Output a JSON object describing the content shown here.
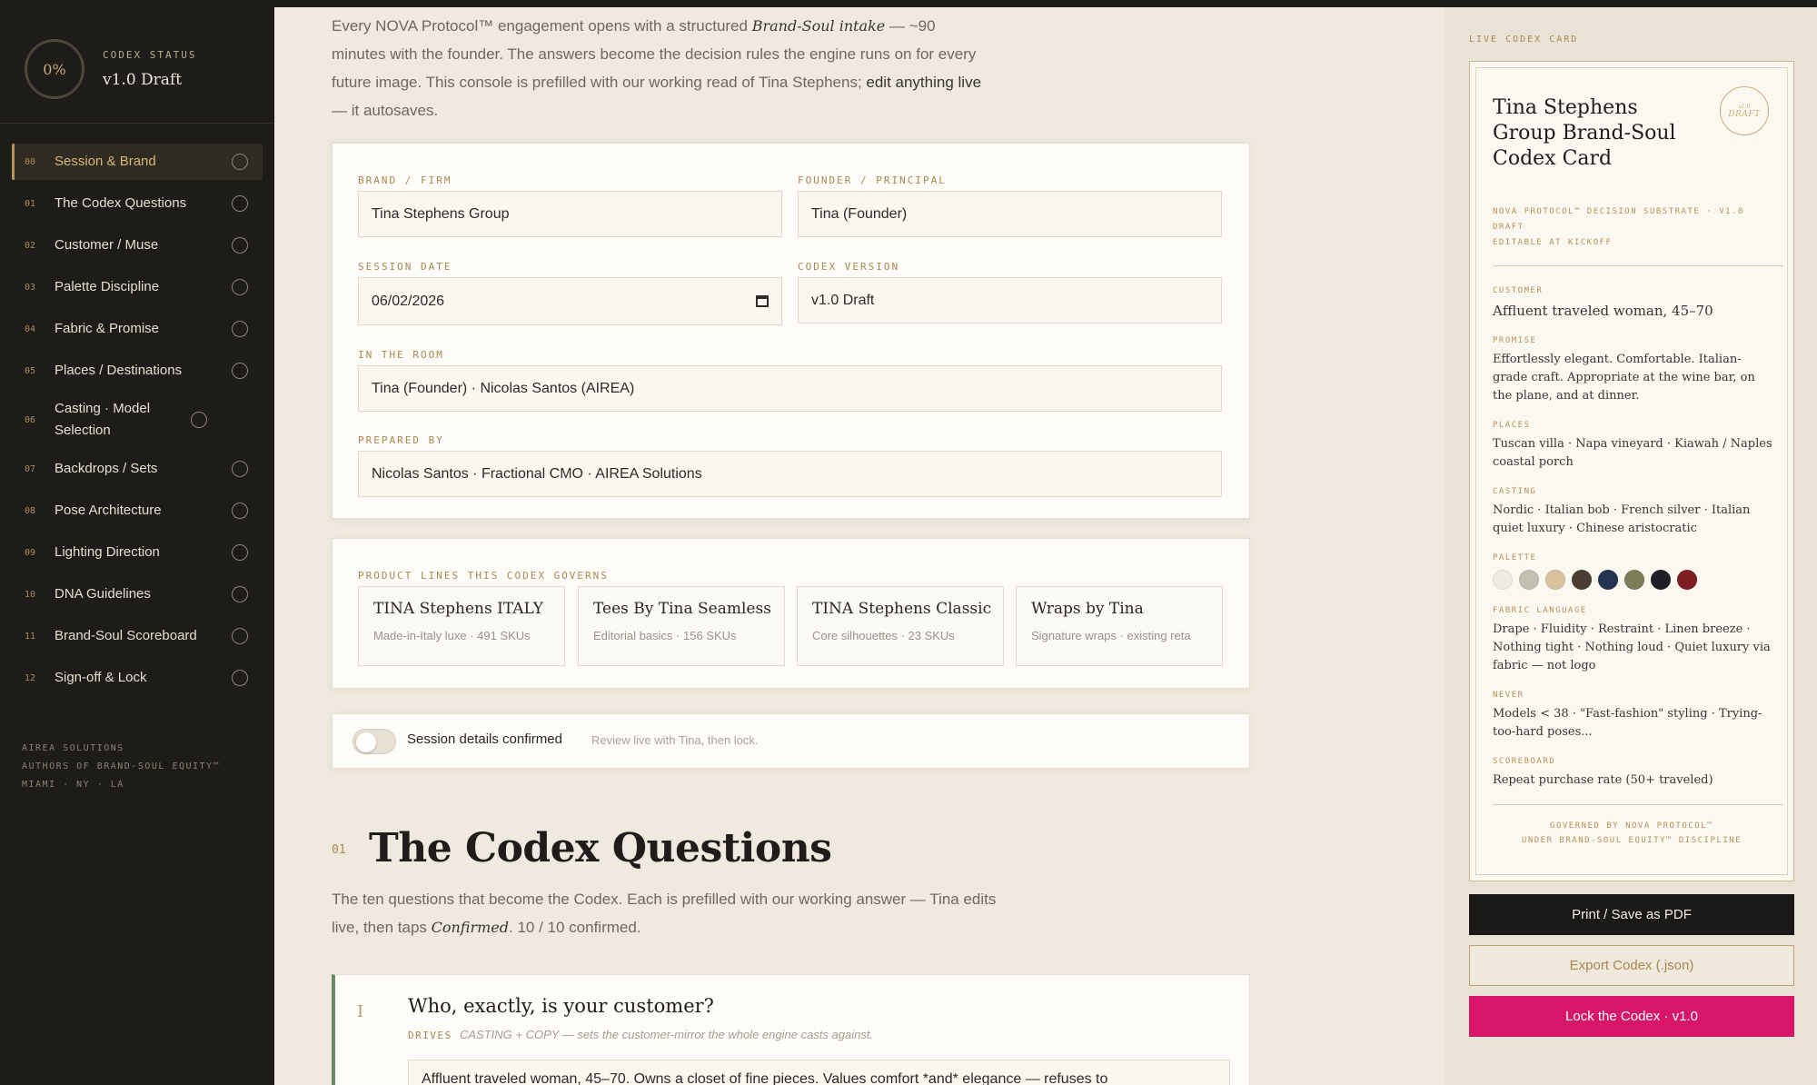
{
  "sidebar": {
    "status_label": "CODEX STATUS",
    "status_value": "v1.0 Draft",
    "progress": "0%",
    "items": [
      {
        "num": "00",
        "label": "Session & Brand"
      },
      {
        "num": "01",
        "label": "The Codex Questions"
      },
      {
        "num": "02",
        "label": "Customer / Muse"
      },
      {
        "num": "03",
        "label": "Palette Discipline"
      },
      {
        "num": "04",
        "label": "Fabric & Promise"
      },
      {
        "num": "05",
        "label": "Places / Destinations"
      },
      {
        "num": "06",
        "label": "Casting · Model Selection"
      },
      {
        "num": "07",
        "label": "Backdrops / Sets"
      },
      {
        "num": "08",
        "label": "Pose Architecture"
      },
      {
        "num": "09",
        "label": "Lighting Direction"
      },
      {
        "num": "10",
        "label": "DNA Guidelines"
      },
      {
        "num": "11",
        "label": "Brand-Soul Scoreboard"
      },
      {
        "num": "12",
        "label": "Sign-off & Lock"
      }
    ],
    "footer": [
      "AIREA SOLUTIONS",
      "AUTHORS OF BRAND-SOUL EQUITY™",
      "MIAMI · NY · LA"
    ]
  },
  "intro": {
    "p1": "Every NOVA Protocol™ engagement opens with a structured ",
    "em": "Brand-Soul intake",
    "p2": " — ~90 minutes with the founder. The answers become the decision rules the engine runs on for every future image. This console is prefilled with our working read of Tina Stephens; ",
    "b": "edit anything live",
    "p3": " — it autosaves."
  },
  "session": {
    "brand_label": "BRAND / FIRM",
    "brand_value": "Tina Stephens Group",
    "founder_label": "FOUNDER / PRINCIPAL",
    "founder_value": "Tina (Founder)",
    "date_label": "SESSION DATE",
    "date_value": "06/02/2026",
    "version_label": "CODEX VERSION",
    "version_value": "v1.0 Draft",
    "room_label": "IN THE ROOM",
    "room_value": "Tina (Founder) · Nicolas Santos (AIREA)",
    "prepared_label": "PREPARED BY",
    "prepared_value": "Nicolas Santos · Fractional CMO · AIREA Solutions"
  },
  "products": {
    "label": "PRODUCT LINES THIS CODEX GOVERNS",
    "items": [
      {
        "title": "TINA Stephens ITALY",
        "sub": "Made-in-Italy luxe · 491 SKUs"
      },
      {
        "title": "Tees By Tina Seamless",
        "sub": "Editorial basics · 156 SKUs"
      },
      {
        "title": "TINA Stephens Classic",
        "sub": "Core silhouettes · 23 SKUs"
      },
      {
        "title": "Wraps by Tina",
        "sub": "Signature wraps · existing reta"
      }
    ]
  },
  "confirm": {
    "label": "Session details confirmed",
    "hint": "Review live with Tina, then lock."
  },
  "section": {
    "num": "01",
    "title": "The Codex Questions",
    "desc1": "The ten questions that become the Codex. Each is prefilled with our working answer — Tina edits live, then taps ",
    "desc_em": "Confirmed",
    "desc2": ". 10 / 10 confirmed."
  },
  "question": {
    "roman": "I",
    "title": "Who, exactly, is your customer?",
    "drives_label": "DRIVES",
    "drives_text": "CASTING + COPY — sets the customer-mirror the whole engine casts against.",
    "answer": "Affluent traveled woman, 45–70. Owns a closet of fine pieces. Values comfort *and* elegance — refuses to"
  },
  "codex": {
    "live_label": "LIVE CODEX CARD",
    "title": "Tina Stephens Group Brand-Soul Codex Card",
    "seal_top": "v1.0",
    "seal_bottom": "DRAFT",
    "sub1": "NOVA PROTOCOL™ DECISION SUBSTRATE · V1.0 DRAFT",
    "sub2": "EDITABLE AT KICKOFF",
    "customer_k": "CUSTOMER",
    "customer_v": "Affluent traveled woman, 45–70",
    "promise_k": "PROMISE",
    "promise_v": "Effortlessly elegant. Comfortable. Italian-grade craft. Appropriate at the wine bar, on the plane, and at dinner.",
    "places_k": "PLACES",
    "places_v": "Tuscan villa · Napa vineyard · Kiawah / Naples coastal porch",
    "casting_k": "CASTING",
    "casting_v": "Nordic · Italian bob · French silver · Italian quiet luxury · Chinese aristocratic",
    "palette_k": "PALETTE",
    "palette": [
      "#efebe2",
      "#c3bfb2",
      "#d9c29d",
      "#4b3d31",
      "#263451",
      "#7b7e57",
      "#1f1f26",
      "#7e1e22"
    ],
    "fabric_k": "FABRIC LANGUAGE",
    "fabric_v": "Drape · Fluidity · Restraint · Linen breeze · Nothing tight · Nothing loud · Quiet luxury via fabric — not logo",
    "never_k": "NEVER",
    "never_v": "Models < 38 · \"Fast-fashion\" styling · Trying-too-hard poses...",
    "score_k": "SCOREBOARD",
    "score_v": "Repeat purchase rate (50+ traveled)",
    "foot1": "GOVERNED BY NOVA PROTOCOL™",
    "foot2": "UNDER BRAND-SOUL EQUITY™ DISCIPLINE"
  },
  "actions": {
    "print": "Print / Save as PDF",
    "export": "Export Codex (.json)",
    "lock": "Lock the Codex · v1.0"
  }
}
